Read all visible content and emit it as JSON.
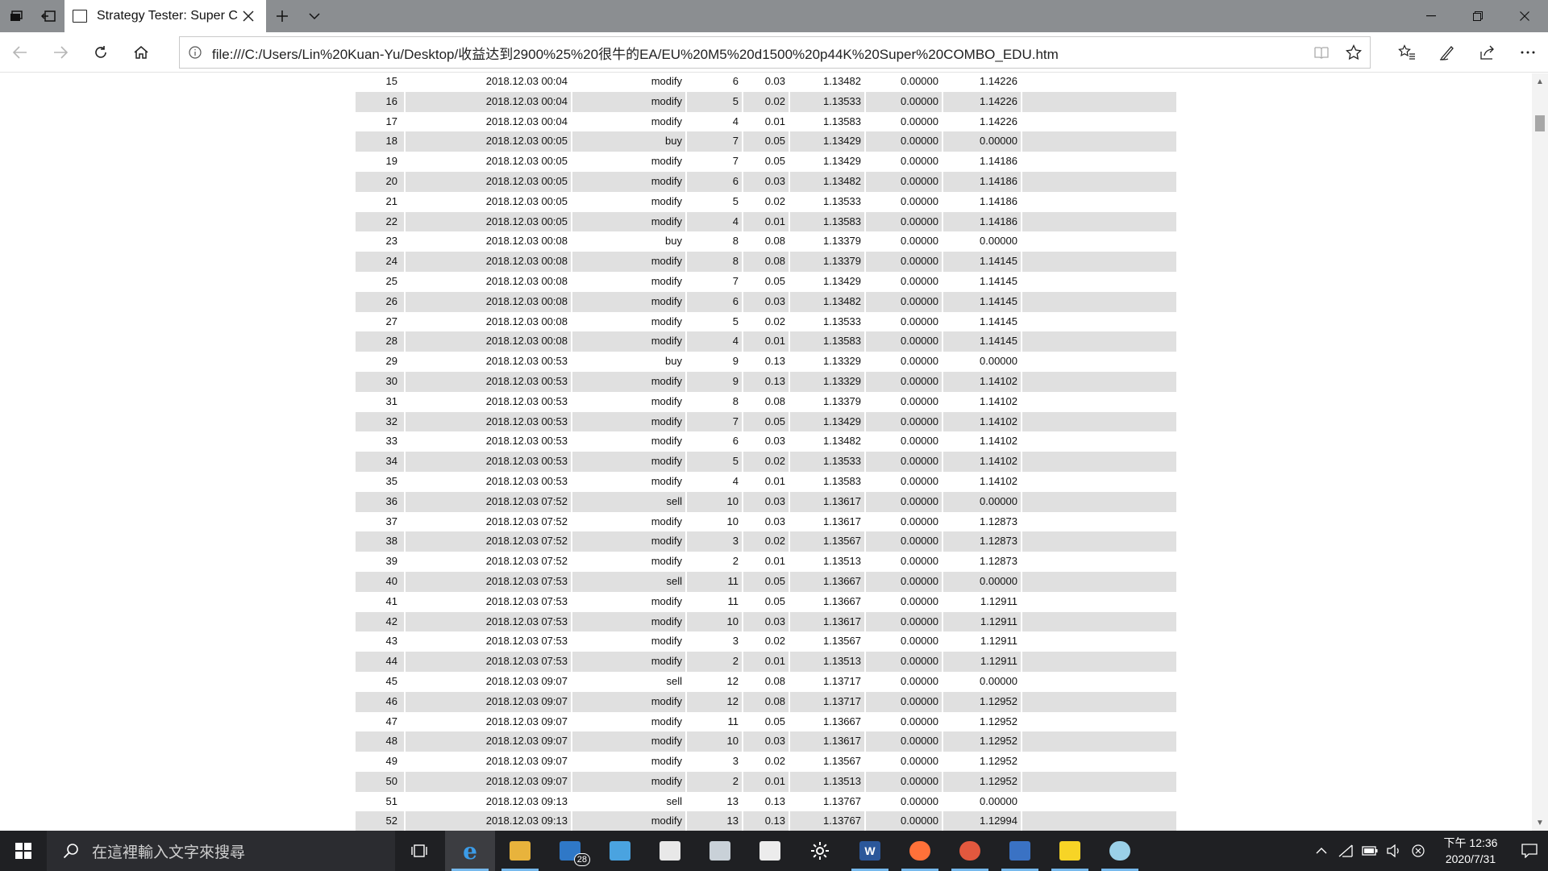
{
  "browser": {
    "tab_title": "Strategy Tester: Super C",
    "url": "file:///C:/Users/Lin%20Kuan-Yu/Desktop/收益达到2900%25%20很牛的EA/EU%20M5%20d1500%20p44K%20Super%20COMBO_EDU.htm"
  },
  "rows": [
    {
      "n": "15",
      "time": "2018.12.03 00:04",
      "type": "modify",
      "order": "6",
      "size": "0.03",
      "price": "1.13482",
      "sl": "0.00000",
      "tp": "1.14226"
    },
    {
      "n": "16",
      "time": "2018.12.03 00:04",
      "type": "modify",
      "order": "5",
      "size": "0.02",
      "price": "1.13533",
      "sl": "0.00000",
      "tp": "1.14226"
    },
    {
      "n": "17",
      "time": "2018.12.03 00:04",
      "type": "modify",
      "order": "4",
      "size": "0.01",
      "price": "1.13583",
      "sl": "0.00000",
      "tp": "1.14226"
    },
    {
      "n": "18",
      "time": "2018.12.03 00:05",
      "type": "buy",
      "order": "7",
      "size": "0.05",
      "price": "1.13429",
      "sl": "0.00000",
      "tp": "0.00000"
    },
    {
      "n": "19",
      "time": "2018.12.03 00:05",
      "type": "modify",
      "order": "7",
      "size": "0.05",
      "price": "1.13429",
      "sl": "0.00000",
      "tp": "1.14186"
    },
    {
      "n": "20",
      "time": "2018.12.03 00:05",
      "type": "modify",
      "order": "6",
      "size": "0.03",
      "price": "1.13482",
      "sl": "0.00000",
      "tp": "1.14186"
    },
    {
      "n": "21",
      "time": "2018.12.03 00:05",
      "type": "modify",
      "order": "5",
      "size": "0.02",
      "price": "1.13533",
      "sl": "0.00000",
      "tp": "1.14186"
    },
    {
      "n": "22",
      "time": "2018.12.03 00:05",
      "type": "modify",
      "order": "4",
      "size": "0.01",
      "price": "1.13583",
      "sl": "0.00000",
      "tp": "1.14186"
    },
    {
      "n": "23",
      "time": "2018.12.03 00:08",
      "type": "buy",
      "order": "8",
      "size": "0.08",
      "price": "1.13379",
      "sl": "0.00000",
      "tp": "0.00000"
    },
    {
      "n": "24",
      "time": "2018.12.03 00:08",
      "type": "modify",
      "order": "8",
      "size": "0.08",
      "price": "1.13379",
      "sl": "0.00000",
      "tp": "1.14145"
    },
    {
      "n": "25",
      "time": "2018.12.03 00:08",
      "type": "modify",
      "order": "7",
      "size": "0.05",
      "price": "1.13429",
      "sl": "0.00000",
      "tp": "1.14145"
    },
    {
      "n": "26",
      "time": "2018.12.03 00:08",
      "type": "modify",
      "order": "6",
      "size": "0.03",
      "price": "1.13482",
      "sl": "0.00000",
      "tp": "1.14145"
    },
    {
      "n": "27",
      "time": "2018.12.03 00:08",
      "type": "modify",
      "order": "5",
      "size": "0.02",
      "price": "1.13533",
      "sl": "0.00000",
      "tp": "1.14145"
    },
    {
      "n": "28",
      "time": "2018.12.03 00:08",
      "type": "modify",
      "order": "4",
      "size": "0.01",
      "price": "1.13583",
      "sl": "0.00000",
      "tp": "1.14145"
    },
    {
      "n": "29",
      "time": "2018.12.03 00:53",
      "type": "buy",
      "order": "9",
      "size": "0.13",
      "price": "1.13329",
      "sl": "0.00000",
      "tp": "0.00000"
    },
    {
      "n": "30",
      "time": "2018.12.03 00:53",
      "type": "modify",
      "order": "9",
      "size": "0.13",
      "price": "1.13329",
      "sl": "0.00000",
      "tp": "1.14102"
    },
    {
      "n": "31",
      "time": "2018.12.03 00:53",
      "type": "modify",
      "order": "8",
      "size": "0.08",
      "price": "1.13379",
      "sl": "0.00000",
      "tp": "1.14102"
    },
    {
      "n": "32",
      "time": "2018.12.03 00:53",
      "type": "modify",
      "order": "7",
      "size": "0.05",
      "price": "1.13429",
      "sl": "0.00000",
      "tp": "1.14102"
    },
    {
      "n": "33",
      "time": "2018.12.03 00:53",
      "type": "modify",
      "order": "6",
      "size": "0.03",
      "price": "1.13482",
      "sl": "0.00000",
      "tp": "1.14102"
    },
    {
      "n": "34",
      "time": "2018.12.03 00:53",
      "type": "modify",
      "order": "5",
      "size": "0.02",
      "price": "1.13533",
      "sl": "0.00000",
      "tp": "1.14102"
    },
    {
      "n": "35",
      "time": "2018.12.03 00:53",
      "type": "modify",
      "order": "4",
      "size": "0.01",
      "price": "1.13583",
      "sl": "0.00000",
      "tp": "1.14102"
    },
    {
      "n": "36",
      "time": "2018.12.03 07:52",
      "type": "sell",
      "order": "10",
      "size": "0.03",
      "price": "1.13617",
      "sl": "0.00000",
      "tp": "0.00000"
    },
    {
      "n": "37",
      "time": "2018.12.03 07:52",
      "type": "modify",
      "order": "10",
      "size": "0.03",
      "price": "1.13617",
      "sl": "0.00000",
      "tp": "1.12873"
    },
    {
      "n": "38",
      "time": "2018.12.03 07:52",
      "type": "modify",
      "order": "3",
      "size": "0.02",
      "price": "1.13567",
      "sl": "0.00000",
      "tp": "1.12873"
    },
    {
      "n": "39",
      "time": "2018.12.03 07:52",
      "type": "modify",
      "order": "2",
      "size": "0.01",
      "price": "1.13513",
      "sl": "0.00000",
      "tp": "1.12873"
    },
    {
      "n": "40",
      "time": "2018.12.03 07:53",
      "type": "sell",
      "order": "11",
      "size": "0.05",
      "price": "1.13667",
      "sl": "0.00000",
      "tp": "0.00000"
    },
    {
      "n": "41",
      "time": "2018.12.03 07:53",
      "type": "modify",
      "order": "11",
      "size": "0.05",
      "price": "1.13667",
      "sl": "0.00000",
      "tp": "1.12911"
    },
    {
      "n": "42",
      "time": "2018.12.03 07:53",
      "type": "modify",
      "order": "10",
      "size": "0.03",
      "price": "1.13617",
      "sl": "0.00000",
      "tp": "1.12911"
    },
    {
      "n": "43",
      "time": "2018.12.03 07:53",
      "type": "modify",
      "order": "3",
      "size": "0.02",
      "price": "1.13567",
      "sl": "0.00000",
      "tp": "1.12911"
    },
    {
      "n": "44",
      "time": "2018.12.03 07:53",
      "type": "modify",
      "order": "2",
      "size": "0.01",
      "price": "1.13513",
      "sl": "0.00000",
      "tp": "1.12911"
    },
    {
      "n": "45",
      "time": "2018.12.03 09:07",
      "type": "sell",
      "order": "12",
      "size": "0.08",
      "price": "1.13717",
      "sl": "0.00000",
      "tp": "0.00000"
    },
    {
      "n": "46",
      "time": "2018.12.03 09:07",
      "type": "modify",
      "order": "12",
      "size": "0.08",
      "price": "1.13717",
      "sl": "0.00000",
      "tp": "1.12952"
    },
    {
      "n": "47",
      "time": "2018.12.03 09:07",
      "type": "modify",
      "order": "11",
      "size": "0.05",
      "price": "1.13667",
      "sl": "0.00000",
      "tp": "1.12952"
    },
    {
      "n": "48",
      "time": "2018.12.03 09:07",
      "type": "modify",
      "order": "10",
      "size": "0.03",
      "price": "1.13617",
      "sl": "0.00000",
      "tp": "1.12952"
    },
    {
      "n": "49",
      "time": "2018.12.03 09:07",
      "type": "modify",
      "order": "3",
      "size": "0.02",
      "price": "1.13567",
      "sl": "0.00000",
      "tp": "1.12952"
    },
    {
      "n": "50",
      "time": "2018.12.03 09:07",
      "type": "modify",
      "order": "2",
      "size": "0.01",
      "price": "1.13513",
      "sl": "0.00000",
      "tp": "1.12952"
    },
    {
      "n": "51",
      "time": "2018.12.03 09:13",
      "type": "sell",
      "order": "13",
      "size": "0.13",
      "price": "1.13767",
      "sl": "0.00000",
      "tp": "0.00000"
    },
    {
      "n": "52",
      "time": "2018.12.03 09:13",
      "type": "modify",
      "order": "13",
      "size": "0.13",
      "price": "1.13767",
      "sl": "0.00000",
      "tp": "1.12994"
    }
  ],
  "taskbar": {
    "search_placeholder": "在這裡輸入文字來搜尋",
    "mail_badge": "28",
    "word_label": "W",
    "clock_time": "下午 12:36",
    "clock_date": "2020/7/31",
    "accent": "#76b9ed"
  },
  "colors": {
    "row_stripe": "#e0e0e0",
    "titlebar": "#8b8e91",
    "taskbar": "#1f2023"
  }
}
